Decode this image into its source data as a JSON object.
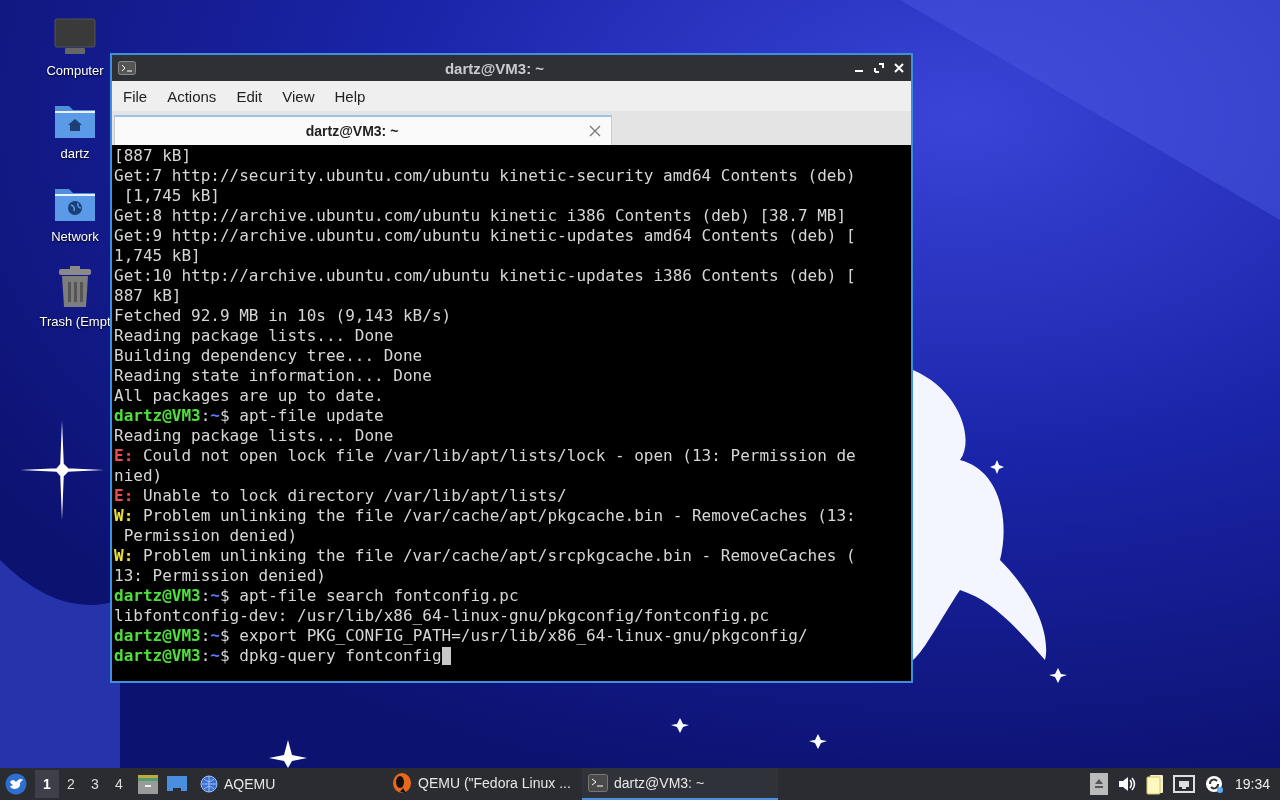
{
  "desktop": {
    "icons": [
      {
        "kind": "computer",
        "label": "Computer"
      },
      {
        "kind": "home",
        "label": "dartz"
      },
      {
        "kind": "network",
        "label": "Network"
      },
      {
        "kind": "trash",
        "label": "Trash (Empt"
      }
    ]
  },
  "window": {
    "title": "dartz@VM3: ~",
    "menu": [
      "File",
      "Actions",
      "Edit",
      "View",
      "Help"
    ],
    "tabs": [
      {
        "label": "dartz@VM3: ~",
        "selected": true
      }
    ],
    "terminal": {
      "lines": [
        {
          "kind": "plain",
          "text": "[887 kB]"
        },
        {
          "kind": "plain",
          "text": "Get:7 http://security.ubuntu.com/ubuntu kinetic-security amd64 Contents (deb)"
        },
        {
          "kind": "plain",
          "text": " [1,745 kB]"
        },
        {
          "kind": "plain",
          "text": "Get:8 http://archive.ubuntu.com/ubuntu kinetic i386 Contents (deb) [38.7 MB]"
        },
        {
          "kind": "plain",
          "text": "Get:9 http://archive.ubuntu.com/ubuntu kinetic-updates amd64 Contents (deb) ["
        },
        {
          "kind": "plain",
          "text": "1,745 kB]"
        },
        {
          "kind": "plain",
          "text": "Get:10 http://archive.ubuntu.com/ubuntu kinetic-updates i386 Contents (deb) ["
        },
        {
          "kind": "plain",
          "text": "887 kB]"
        },
        {
          "kind": "plain",
          "text": "Fetched 92.9 MB in 10s (9,143 kB/s)"
        },
        {
          "kind": "plain",
          "text": "Reading package lists... Done"
        },
        {
          "kind": "plain",
          "text": "Building dependency tree... Done"
        },
        {
          "kind": "plain",
          "text": "Reading state information... Done"
        },
        {
          "kind": "plain",
          "text": "All packages are up to date."
        },
        {
          "kind": "prompt",
          "user": "dartz@VM3",
          "separator": ":",
          "path": "~",
          "symbol": "$",
          "command": "apt-file update",
          "cursor": false
        },
        {
          "kind": "plain",
          "text": "Reading package lists... Done"
        },
        {
          "kind": "error",
          "tag": "E:",
          "text": "Could not open lock file /var/lib/apt/lists/lock - open (13: Permission de"
        },
        {
          "kind": "plain",
          "text": "nied)"
        },
        {
          "kind": "error",
          "tag": "E:",
          "text": "Unable to lock directory /var/lib/apt/lists/"
        },
        {
          "kind": "warning",
          "tag": "W:",
          "text": "Problem unlinking the file /var/cache/apt/pkgcache.bin - RemoveCaches (13:"
        },
        {
          "kind": "plain",
          "text": " Permission denied)"
        },
        {
          "kind": "warning",
          "tag": "W:",
          "text": "Problem unlinking the file /var/cache/apt/srcpkgcache.bin - RemoveCaches ("
        },
        {
          "kind": "plain",
          "text": "13: Permission denied)"
        },
        {
          "kind": "prompt",
          "user": "dartz@VM3",
          "separator": ":",
          "path": "~",
          "symbol": "$",
          "command": "apt-file search fontconfig.pc",
          "cursor": false
        },
        {
          "kind": "plain",
          "text": "libfontconfig-dev: /usr/lib/x86_64-linux-gnu/pkgconfig/fontconfig.pc"
        },
        {
          "kind": "prompt",
          "user": "dartz@VM3",
          "separator": ":",
          "path": "~",
          "symbol": "$",
          "command": "export PKG_CONFIG_PATH=/usr/lib/x86_64-linux-gnu/pkgconfig/",
          "cursor": false
        },
        {
          "kind": "prompt",
          "user": "dartz@VM3",
          "separator": ":",
          "path": "~",
          "symbol": "$",
          "command": "dpkg-query fontconfig",
          "cursor": true
        }
      ]
    }
  },
  "taskbar": {
    "workspaces": [
      {
        "label": "1",
        "selected": true
      },
      {
        "label": "2",
        "selected": false
      },
      {
        "label": "3",
        "selected": false
      },
      {
        "label": "4",
        "selected": false
      }
    ],
    "launchers": [
      {
        "kind": "globe",
        "label": "AQEMU"
      }
    ],
    "tasks": [
      {
        "kind": "qemu",
        "label": "QEMU (\"Fedora Linux ...",
        "selected": false
      },
      {
        "kind": "terminal",
        "label": "dartz@VM3: ~",
        "selected": true
      }
    ],
    "clock": "19:34"
  }
}
